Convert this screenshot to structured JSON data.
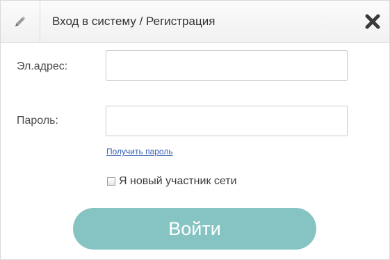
{
  "dialog": {
    "title": "Вход в систему / Регистрация"
  },
  "form": {
    "email_label": "Эл.адрес:",
    "email_value": "",
    "password_label": "Пароль:",
    "password_value": "",
    "get_password_link": "Получить пароль",
    "new_member_label": "Я новый участник сети",
    "new_member_checked": false,
    "submit_label": "Войти"
  },
  "icons": {
    "title_icon": "pencil-icon",
    "close_icon": "close-icon"
  },
  "colors": {
    "submit_bg": "#86c4c3",
    "link": "#3a63b5",
    "title_bar": "#f4f4f4"
  }
}
